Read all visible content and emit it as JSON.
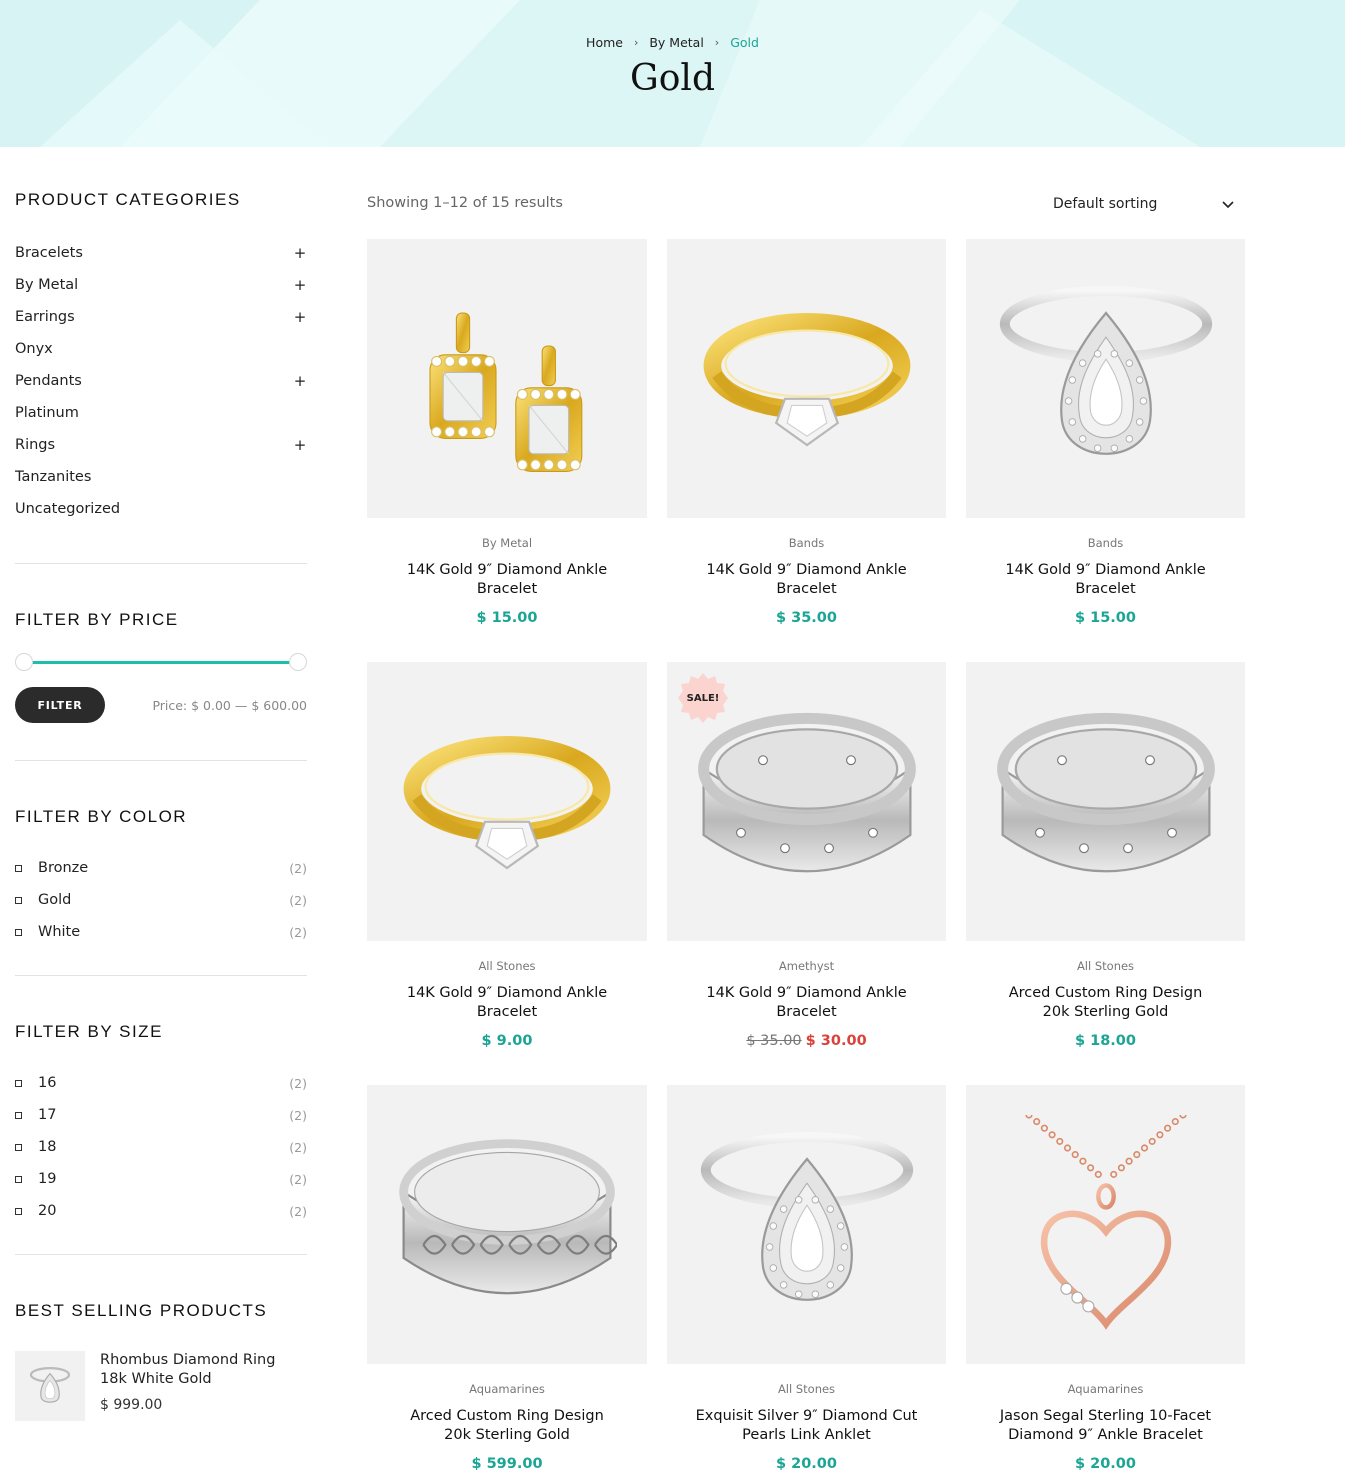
{
  "breadcrumb": {
    "home": "Home",
    "parent": "By Metal",
    "current": "Gold"
  },
  "page_title": "Gold",
  "sidebar": {
    "categories_title": "PRODUCT CATEGORIES",
    "categories": [
      {
        "label": "Bracelets",
        "expandable": true
      },
      {
        "label": "By Metal",
        "expandable": true
      },
      {
        "label": "Earrings",
        "expandable": true
      },
      {
        "label": "Onyx",
        "expandable": false
      },
      {
        "label": "Pendants",
        "expandable": true
      },
      {
        "label": "Platinum",
        "expandable": false
      },
      {
        "label": "Rings",
        "expandable": true
      },
      {
        "label": "Tanzanites",
        "expandable": false
      },
      {
        "label": "Uncategorized",
        "expandable": false
      }
    ],
    "expand_symbol": "+",
    "price_title": "FILTER BY PRICE",
    "price_range": {
      "min": 0,
      "max": 600
    },
    "filter_button": "FILTER",
    "price_label": "Price: $ 0.00 — $ 600.00",
    "color_title": "FILTER BY COLOR",
    "colors": [
      {
        "label": "Bronze",
        "count": "(2)"
      },
      {
        "label": "Gold",
        "count": "(2)"
      },
      {
        "label": "White",
        "count": "(2)"
      }
    ],
    "size_title": "FILTER BY SIZE",
    "sizes": [
      {
        "label": "16",
        "count": "(2)"
      },
      {
        "label": "17",
        "count": "(2)"
      },
      {
        "label": "18",
        "count": "(2)"
      },
      {
        "label": "19",
        "count": "(2)"
      },
      {
        "label": "20",
        "count": "(2)"
      }
    ],
    "best_title": "BEST SELLING PRODUCTS",
    "best": {
      "name": "Rhombus Diamond Ring 18k White Gold",
      "price": "$ 999.00",
      "icon": "white-pear-ring-icon"
    }
  },
  "toolbar": {
    "result_count": "Showing 1–12 of 15 results",
    "sorting": "Default sorting"
  },
  "colors": {
    "accent": "#1aa594",
    "slider": "#1cbfa9",
    "sale_price": "#d9433a",
    "sale_badge": "#fbd3cf",
    "banner": "#e3f8f8"
  },
  "products": [
    {
      "category": "By Metal",
      "name": "14K Gold 9″ Diamond Ankle Bracelet",
      "price": "$ 15.00",
      "icon": "gold-earrings-icon"
    },
    {
      "category": "Bands",
      "name": "14K Gold 9″ Diamond Ankle Bracelet",
      "price": "$ 35.00",
      "icon": "gold-ring-icon"
    },
    {
      "category": "Bands",
      "name": "14K Gold 9″ Diamond Ankle Bracelet",
      "price": "$ 15.00",
      "icon": "silver-pear-ring-icon"
    },
    {
      "category": "All Stones",
      "name": "14K Gold 9″ Diamond Ankle Bracelet",
      "price": "$ 9.00",
      "icon": "gold-ring-icon"
    },
    {
      "category": "Amethyst",
      "name": "14K Gold 9″ Diamond Ankle Bracelet",
      "old_price": "$ 35.00",
      "price": "$ 30.00",
      "sale": "SALE!",
      "icon": "silver-band-icon"
    },
    {
      "category": "All Stones",
      "name": "Arced Custom Ring Design 20k Sterling Gold",
      "price": "$ 18.00",
      "icon": "silver-band-icon"
    },
    {
      "category": "Aquamarines",
      "name": "Arced Custom Ring Design 20k Sterling Gold",
      "price": "$ 599.00",
      "icon": "filigree-band-icon"
    },
    {
      "category": "All Stones",
      "name": "Exquisit Silver 9″ Diamond Cut Pearls Link Anklet",
      "price": "$ 20.00",
      "icon": "silver-pear-ring-icon"
    },
    {
      "category": "Aquamarines",
      "name": "Jason Segal Sterling 10-Facet Diamond 9″ Ankle Bracelet",
      "price": "$ 20.00",
      "icon": "heart-pendant-icon"
    }
  ]
}
